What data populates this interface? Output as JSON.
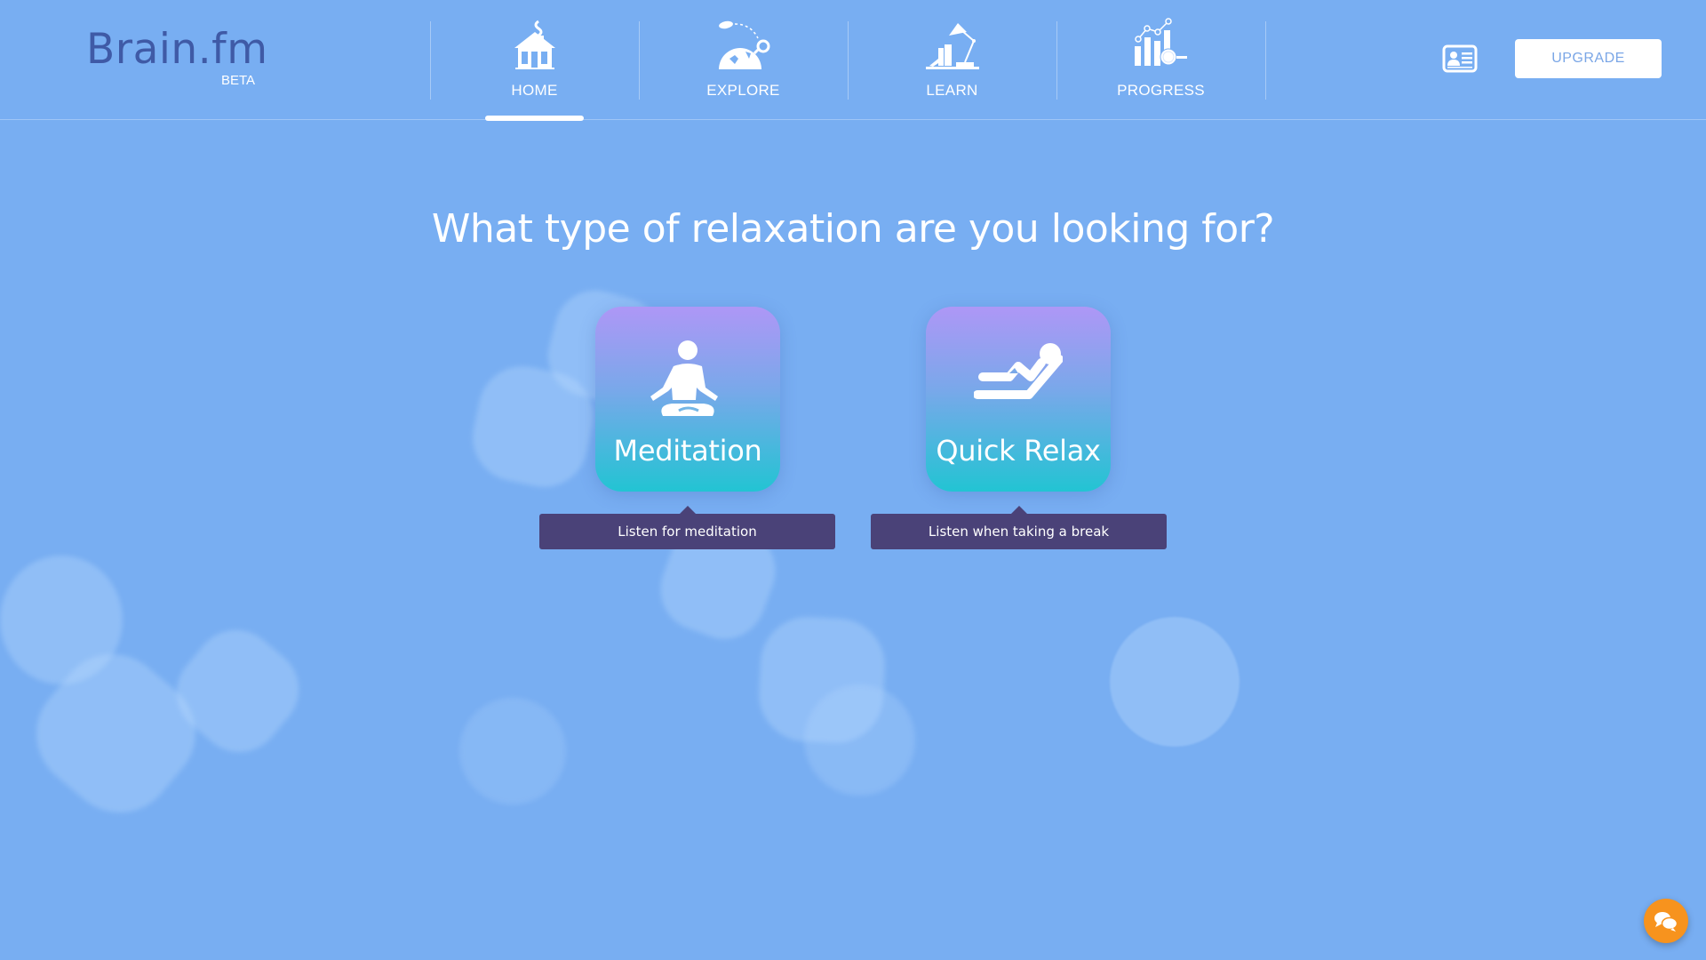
{
  "app": {
    "logo_text": "Brain.fm",
    "logo_badge": "BETA"
  },
  "nav": {
    "items": [
      {
        "label": "HOME",
        "icon": "house-icon",
        "active": true
      },
      {
        "label": "EXPLORE",
        "icon": "globe-rocket-icon",
        "active": false
      },
      {
        "label": "LEARN",
        "icon": "desk-lamp-books-icon",
        "active": false
      },
      {
        "label": "PROGRESS",
        "icon": "chart-magnifier-icon",
        "active": false
      }
    ]
  },
  "header_actions": {
    "profile_icon": "id-card-icon",
    "upgrade_label": "UPGRADE"
  },
  "main": {
    "headline": "What type of relaxation are you looking for?",
    "options": [
      {
        "label": "Meditation",
        "icon": "meditation-pose-icon",
        "tooltip": "Listen for meditation"
      },
      {
        "label": "Quick Relax",
        "icon": "reclining-person-icon",
        "tooltip": "Listen when taking a break"
      }
    ]
  },
  "chat": {
    "icon": "chat-bubbles-icon"
  },
  "colors": {
    "background": "#78aef2",
    "logo": "#3f5aa6",
    "card_gradient_top": "#ae97f6",
    "card_gradient_bottom": "#22c4d3",
    "tooltip": "#4a4278",
    "chat_button": "#f7931e",
    "upgrade_text": "#7aa6e6"
  }
}
